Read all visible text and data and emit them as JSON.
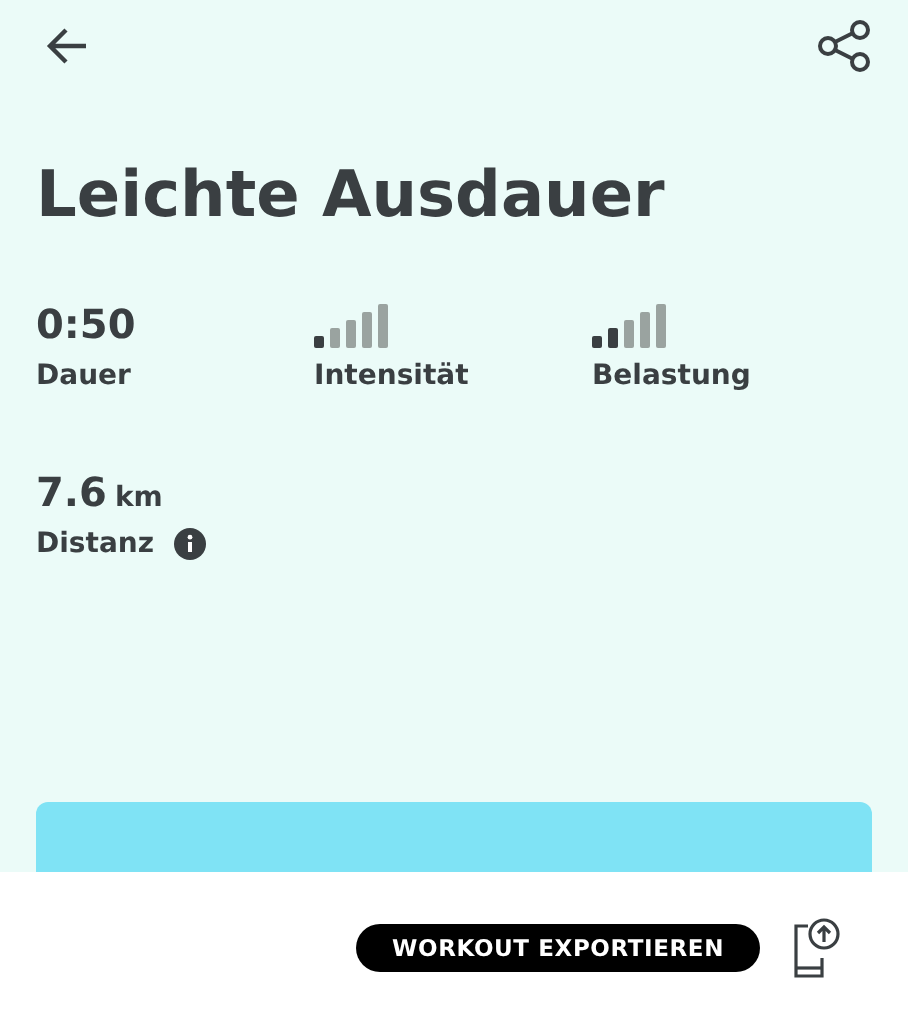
{
  "title": "Leichte Ausdauer",
  "stats": [
    {
      "kind": "value",
      "value": "0:50",
      "label": "Dauer"
    },
    {
      "kind": "bars",
      "level": 0.2,
      "label": "Intensität"
    },
    {
      "kind": "bars",
      "level": 0.4,
      "label": "Belastung"
    }
  ],
  "distance": {
    "value": "7.6",
    "unit": "km",
    "label": "Distanz"
  },
  "export_button": "WORKOUT EXPORTIEREN"
}
